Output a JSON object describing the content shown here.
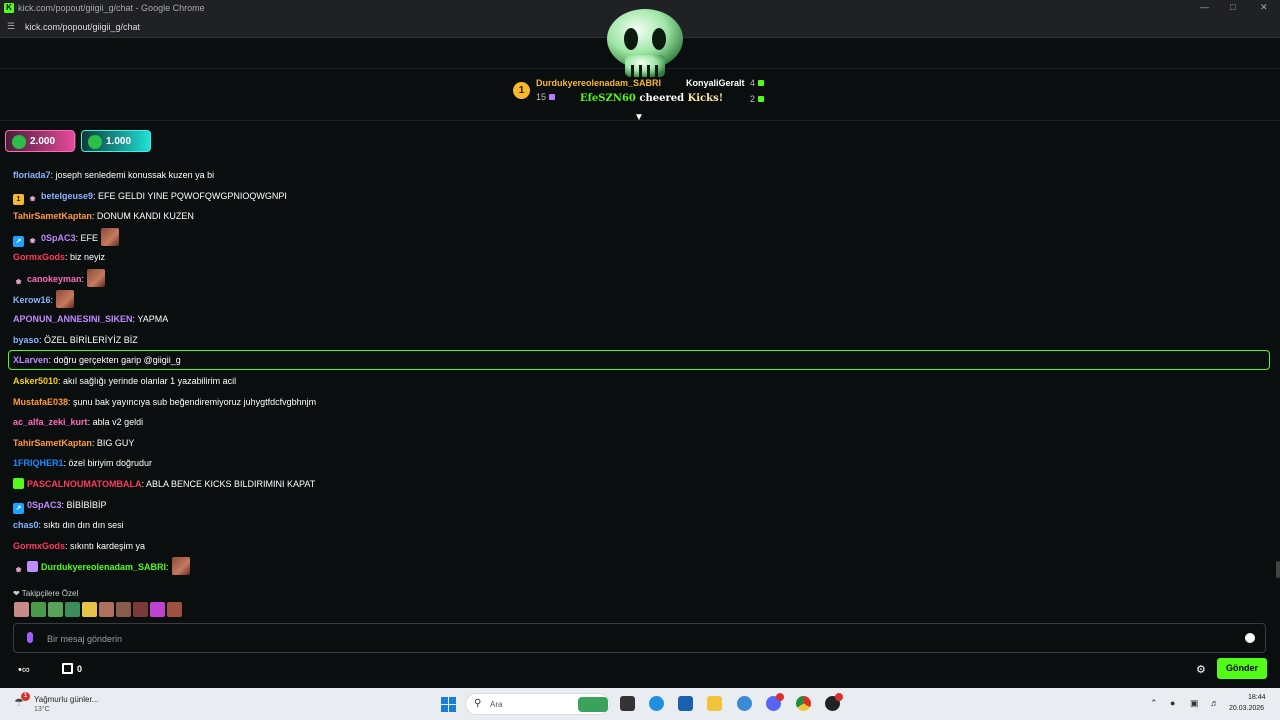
{
  "browser": {
    "window_title": "kick.com/popout/giigii_g/chat - Google Chrome",
    "url": "kick.com/popout/giigii_g/chat"
  },
  "leaderboard": {
    "first": {
      "rank": "1",
      "name": "Durdukyereolenadam_SABRI",
      "count": "15"
    },
    "second": {
      "name": "KonyaliGeralt",
      "count": "4"
    },
    "third": {
      "count": "2"
    },
    "cheer": {
      "name": "EfeSZN60",
      "verb": "cheered",
      "kicks": "Kicks!"
    }
  },
  "pinned_gifts": [
    {
      "value": "2.000"
    },
    {
      "value": "1.000"
    }
  ],
  "chat": {
    "messages": [
      {
        "user": "floriada7",
        "color": "#8ab4ff",
        "text": ": joseph senledemi konussak kuzen ya bi",
        "badges": []
      },
      {
        "user": "betelgeuse9",
        "color": "#8ab4ff",
        "text": ": EFE GELDI YINE PQWOFQWGPNIOQWGNPI",
        "badges": [
          "gift",
          "butterfly"
        ]
      },
      {
        "user": "TahirSametKaptan",
        "color": "#ff9a3c",
        "text": ": DONUM KANDI KUZEN",
        "badges": []
      },
      {
        "user": "0SpAC3",
        "color": "#c18aff",
        "text": ": EFE",
        "badges": [
          "vip",
          "butterfly"
        ],
        "emote": true
      },
      {
        "user": "GormxGods",
        "color": "#ff3b5c",
        "text": ": biz neyiz",
        "badges": []
      },
      {
        "user": "canokeyman",
        "color": "#ff6ab8",
        "text": ":",
        "badges": [
          "butterfly"
        ],
        "emote": true
      },
      {
        "user": "Kerow16",
        "color": "#8ab4ff",
        "text": ":",
        "badges": [],
        "emote": true
      },
      {
        "user": "APONUN_ANNESINI_SIKEN",
        "color": "#c18aff",
        "text": ": YAPMA",
        "badges": []
      },
      {
        "user": "byaso",
        "color": "#8ab4ff",
        "text": ": ÖZEL BİRİLERİYİZ BİZ",
        "badges": []
      },
      {
        "user": "XLarven",
        "color": "#c18aff",
        "text": ": doğru gerçekten garip @giigii_g",
        "badges": []
      },
      {
        "user": "Asker5010",
        "color": "#f5d020",
        "text": ": akıl sağlığı yerinde olanlar 1 yazabilirim acil",
        "badges": []
      },
      {
        "user": "MustafaE038",
        "color": "#ff9a3c",
        "text": ": şunu bak yayıncıya sub beğendiremiyoruz juhygtfdcfvgbhnjm",
        "badges": []
      },
      {
        "user": "ac_alfa_zeki_kurt",
        "color": "#ff6ab8",
        "text": ": abla v2 geldi",
        "badges": []
      },
      {
        "user": "TahirSametKaptan",
        "color": "#ff9a3c",
        "text": ": BIG GUY",
        "badges": []
      },
      {
        "user": "1FRIQHER1",
        "color": "#1a8cff",
        "text": ": özel biriyim doğrudur",
        "badges": []
      },
      {
        "user": "PASCALNOUMATOMBALA",
        "color": "#ff3b5c",
        "text": ": ABLA BENCE KICKS BILDIRIMINI KAPAT",
        "badges": [
          "green"
        ]
      },
      {
        "user": "0SpAC3",
        "color": "#c18aff",
        "text": ": BİBİBİBİP",
        "badges": [
          "vip"
        ]
      },
      {
        "user": "chas0",
        "color": "#8ab4ff",
        "text": ": sıktı dın dın dın sesi",
        "badges": []
      },
      {
        "user": "GormxGods",
        "color": "#ff3b5c",
        "text": ": sıkıntı kardeşim ya",
        "badges": []
      },
      {
        "user": "Durdukyereolenadam_SABRI",
        "color": "#53fc18",
        "text": ":",
        "badges": [
          "butterfly",
          "purple"
        ],
        "emote": true
      }
    ],
    "highlighted_index": 9
  },
  "followers_label": "Takipçilere Özel",
  "input": {
    "placeholder": "Bir mesaj gönderin",
    "value": ""
  },
  "bottom": {
    "item_count": "0",
    "send_label": "Gönder"
  },
  "taskbar": {
    "weather_title": "Yağmurlu günler...",
    "weather_temp": "13°C",
    "weather_badge": "1",
    "search_placeholder": "Ara",
    "time": "18:44",
    "date": "20.03.2026"
  },
  "colors": {
    "accent": "#53fc18",
    "background": "#0b0e0f",
    "highlight_border": "#53fc18"
  }
}
